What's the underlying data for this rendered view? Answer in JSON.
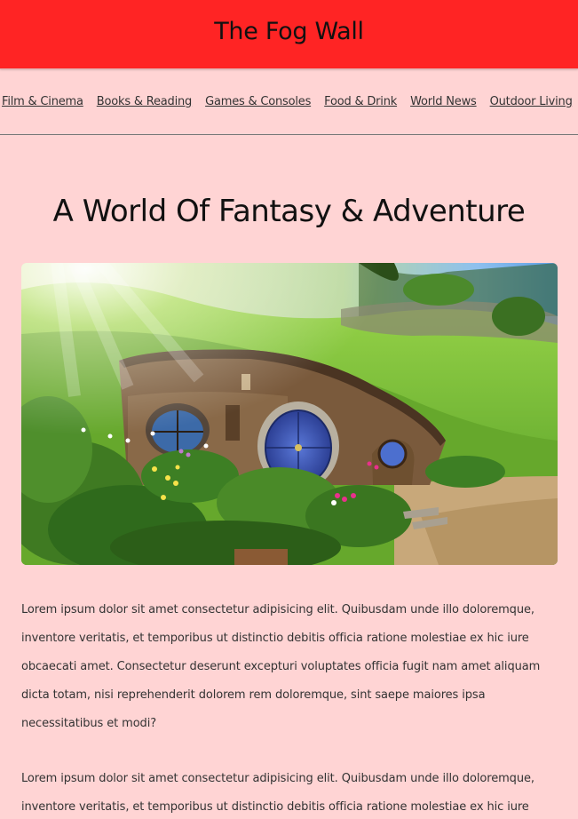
{
  "header": {
    "title": "The Fog Wall"
  },
  "nav": {
    "items": [
      {
        "label": "Film & Cinema"
      },
      {
        "label": "Books & Reading"
      },
      {
        "label": "Games & Consoles"
      },
      {
        "label": "Food & Drink"
      },
      {
        "label": "World News"
      },
      {
        "label": "Outdoor Living"
      }
    ]
  },
  "article": {
    "title": "A World Of Fantasy & Adventure",
    "paragraphs": [
      "Lorem ipsum dolor sit amet consectetur adipisicing elit. Quibusdam unde illo doloremque, inventore veritatis, et temporibus ut distinctio debitis officia ratione molestiae ex hic iure obcaecati amet. Consectetur deserunt excepturi voluptates officia fugit nam amet aliquam dicta totam, nisi reprehenderit dolorem rem doloremque, sint saepe maiores ipsa necessitatibus et modi?",
      "Lorem ipsum dolor sit amet consectetur adipisicing elit. Quibusdam unde illo doloremque, inventore veritatis, et temporibus ut distinctio debitis officia ratione molestiae ex hic iure"
    ]
  },
  "colors": {
    "header_bg": "#ff2424",
    "page_bg": "#ffd4d4"
  }
}
